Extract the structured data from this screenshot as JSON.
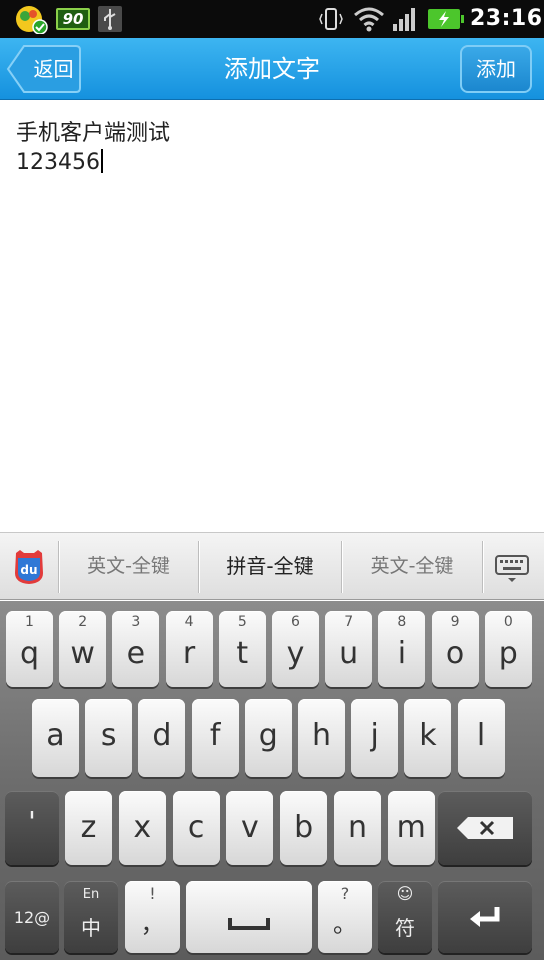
{
  "status_bar": {
    "battery_small_label": "90",
    "time": "23:16",
    "icons": [
      "app-icon",
      "battery-90-icon",
      "usb-icon",
      "vibrate-icon",
      "wifi-icon",
      "signal-icon",
      "battery-charging-icon"
    ]
  },
  "header": {
    "back_label": "返回",
    "title": "添加文字",
    "add_label": "添加"
  },
  "editor": {
    "lines": [
      "手机客户端测试",
      "123456"
    ]
  },
  "candidate_bar": {
    "logo": "du",
    "items": [
      "英文-全键",
      "拼音-全键",
      "英文-全键"
    ],
    "active_index": 1,
    "icon": "keyboard-toggle-icon"
  },
  "keyboard": {
    "row1": [
      {
        "num": "1",
        "main": "q"
      },
      {
        "num": "2",
        "main": "w"
      },
      {
        "num": "3",
        "main": "e"
      },
      {
        "num": "4",
        "main": "r"
      },
      {
        "num": "5",
        "main": "t"
      },
      {
        "num": "6",
        "main": "y"
      },
      {
        "num": "7",
        "main": "u"
      },
      {
        "num": "8",
        "main": "i"
      },
      {
        "num": "9",
        "main": "o"
      },
      {
        "num": "0",
        "main": "p"
      }
    ],
    "row2": [
      "a",
      "s",
      "d",
      "f",
      "g",
      "h",
      "j",
      "k",
      "l"
    ],
    "row3": [
      "z",
      "x",
      "c",
      "v",
      "b",
      "n",
      "m"
    ],
    "apostrophe": "'",
    "numbers_key": "12@",
    "lang_key": {
      "top": "En",
      "main": "中"
    },
    "comma_key": {
      "top": "!",
      "main": "，"
    },
    "period_key": {
      "top": "?",
      "main": "。"
    },
    "symbol_key": {
      "top": "☺",
      "main": "符"
    }
  }
}
